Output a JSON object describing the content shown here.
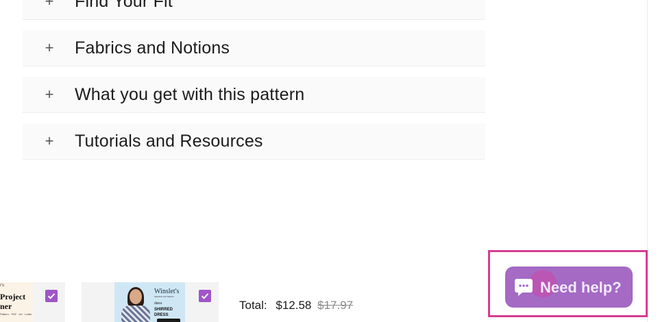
{
  "accordion": {
    "items": [
      {
        "icon": "plus-icon",
        "symbol": "+",
        "title": "Find Your Fit"
      },
      {
        "icon": "plus-icon",
        "symbol": "+",
        "title": "Fabrics and Notions"
      },
      {
        "icon": "plus-icon",
        "symbol": "+",
        "title": "What you get with this pattern"
      },
      {
        "icon": "plus-icon",
        "symbol": "+",
        "title": "Tutorials and Resources"
      }
    ]
  },
  "bundle": {
    "products": [
      {
        "thumb_small": "r's",
        "thumb_title_1": "Project",
        "thumb_title_2": "ner",
        "thumb_foot": "Pattern · PDF · A4 · Letter",
        "checked": true
      },
      {
        "brand": "Winslet's",
        "brand_sub": "SEWING PATTERNS",
        "name": "dana",
        "title_1": "SHIRRED",
        "title_2": "DRESS",
        "checked": true
      }
    ],
    "total": {
      "label": "Total:",
      "price": "$12.58",
      "compare_price": "$17.97"
    },
    "check_color": "#9f55c8"
  },
  "help_widget": {
    "label": "Need help?",
    "icon": "chat-bubble-icon",
    "color": "#a46ac4",
    "highlight_color": "#d63c8f"
  }
}
